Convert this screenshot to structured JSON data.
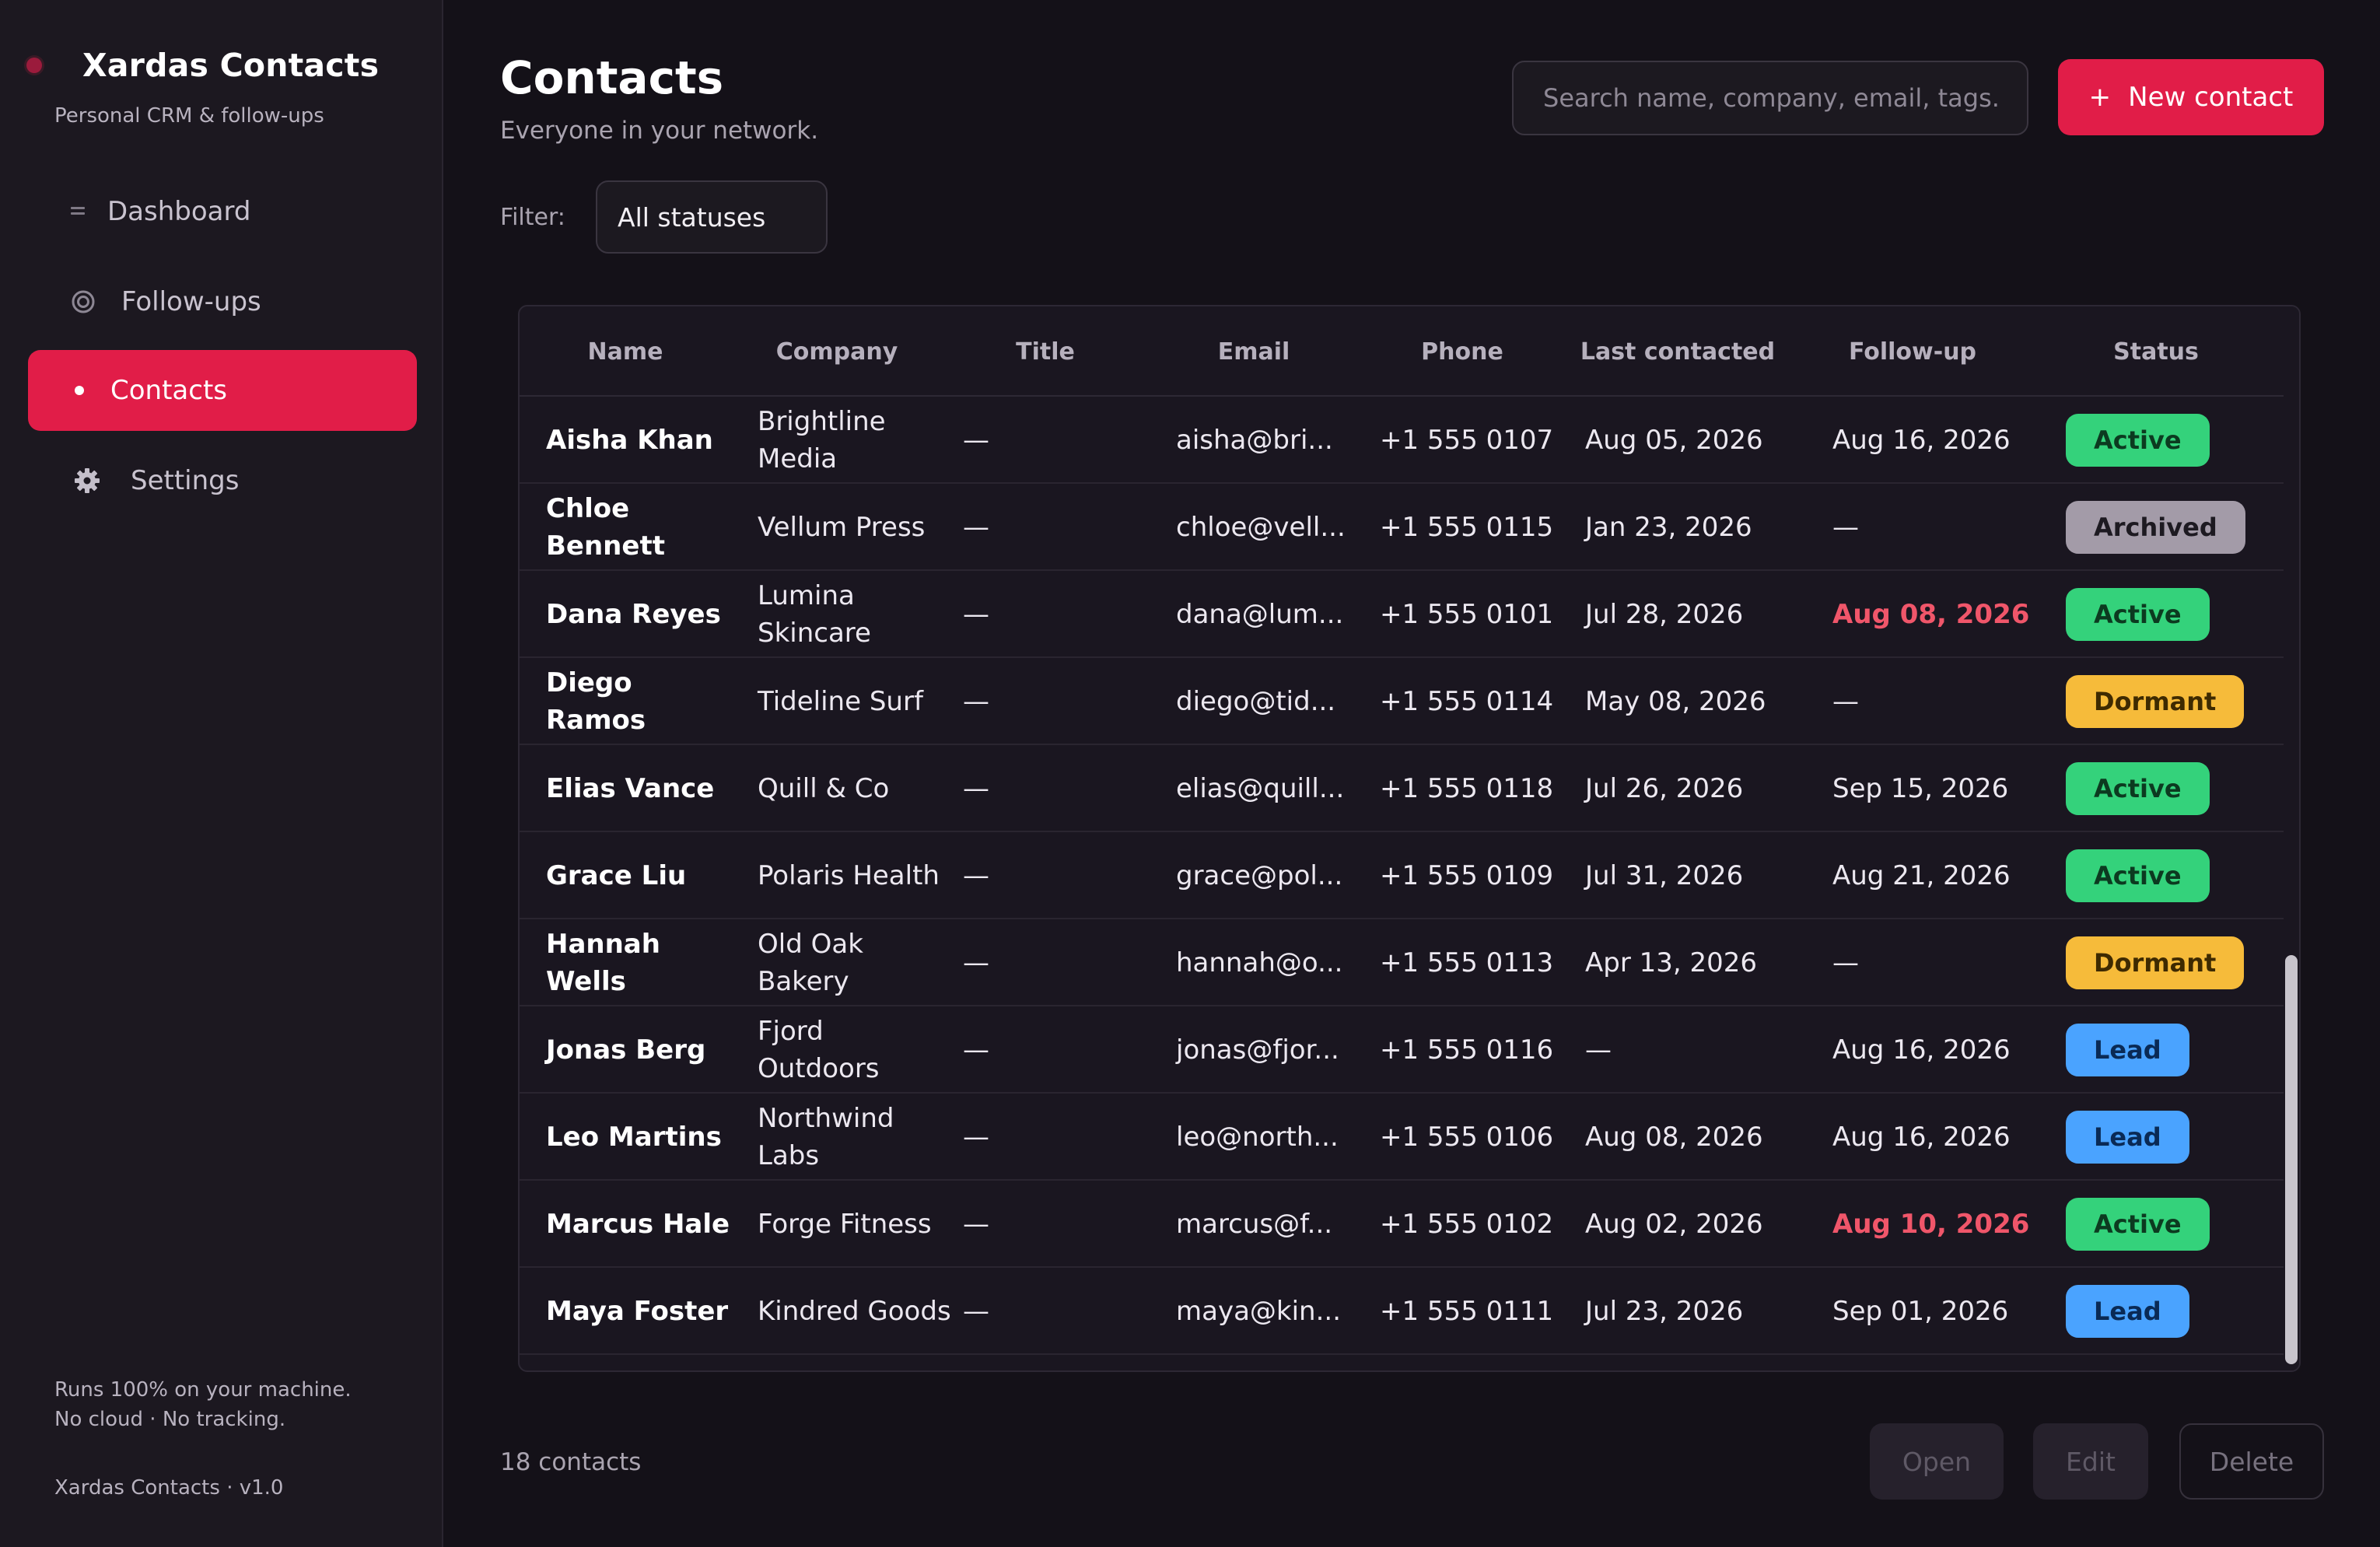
{
  "app": {
    "name": "Xardas Contacts",
    "tagline": "Personal CRM & follow-ups",
    "accent_color": "#e11d48"
  },
  "sidebar": {
    "items": [
      {
        "label": "Dashboard",
        "icon": "dashboard-icon",
        "active": false
      },
      {
        "label": "Follow-ups",
        "icon": "target-icon",
        "active": false
      },
      {
        "label": "Contacts",
        "icon": "dot-icon",
        "active": true
      },
      {
        "label": "Settings",
        "icon": "gear-icon",
        "active": false
      }
    ],
    "privacy_line1": "Runs 100% on your machine.",
    "privacy_line2": "No cloud · No tracking.",
    "version": "Xardas Contacts · v1.0"
  },
  "header": {
    "title": "Contacts",
    "subtitle": "Everyone in your network.",
    "search_placeholder": "Search name, company, email, tags...",
    "new_button_icon": "+",
    "new_button_label": "New contact"
  },
  "filter": {
    "label": "Filter:",
    "selected": "All statuses"
  },
  "table": {
    "columns": [
      "Name",
      "Company",
      "Title",
      "Email",
      "Phone",
      "Last contacted",
      "Follow-up",
      "Status"
    ],
    "rows": [
      {
        "name": "Aisha Khan",
        "company": "Brightline Media",
        "title": "—",
        "email": "aisha@bri...",
        "phone": "+1 555 0107",
        "last": "Aug 05, 2026",
        "follow": "Aug 16, 2026",
        "overdue": false,
        "status": "Active"
      },
      {
        "name": "Chloe Bennett",
        "company": "Vellum Press",
        "title": "—",
        "email": "chloe@vell...",
        "phone": "+1 555 0115",
        "last": "Jan 23, 2026",
        "follow": "—",
        "overdue": false,
        "status": "Archived"
      },
      {
        "name": "Dana Reyes",
        "company": "Lumina Skincare",
        "title": "—",
        "email": "dana@lum...",
        "phone": "+1 555 0101",
        "last": "Jul 28, 2026",
        "follow": "Aug 08, 2026",
        "overdue": true,
        "status": "Active"
      },
      {
        "name": "Diego Ramos",
        "company": "Tideline Surf",
        "title": "—",
        "email": "diego@tid...",
        "phone": "+1 555 0114",
        "last": "May 08, 2026",
        "follow": "—",
        "overdue": false,
        "status": "Dormant"
      },
      {
        "name": "Elias Vance",
        "company": "Quill & Co",
        "title": "—",
        "email": "elias@quill...",
        "phone": "+1 555 0118",
        "last": "Jul 26, 2026",
        "follow": "Sep 15, 2026",
        "overdue": false,
        "status": "Active"
      },
      {
        "name": "Grace Liu",
        "company": "Polaris Health",
        "title": "—",
        "email": "grace@pol...",
        "phone": "+1 555 0109",
        "last": "Jul 31, 2026",
        "follow": "Aug 21, 2026",
        "overdue": false,
        "status": "Active"
      },
      {
        "name": "Hannah Wells",
        "company": "Old Oak Bakery",
        "title": "—",
        "email": "hannah@o...",
        "phone": "+1 555 0113",
        "last": "Apr 13, 2026",
        "follow": "—",
        "overdue": false,
        "status": "Dormant"
      },
      {
        "name": "Jonas Berg",
        "company": "Fjord Outdoors",
        "title": "—",
        "email": "jonas@fjor...",
        "phone": "+1 555 0116",
        "last": "—",
        "follow": "Aug 16, 2026",
        "overdue": false,
        "status": "Lead"
      },
      {
        "name": "Leo Martins",
        "company": "Northwind Labs",
        "title": "—",
        "email": "leo@north...",
        "phone": "+1 555 0106",
        "last": "Aug 08, 2026",
        "follow": "Aug 16, 2026",
        "overdue": false,
        "status": "Lead"
      },
      {
        "name": "Marcus Hale",
        "company": "Forge Fitness",
        "title": "—",
        "email": "marcus@f...",
        "phone": "+1 555 0102",
        "last": "Aug 02, 2026",
        "follow": "Aug 10, 2026",
        "overdue": true,
        "status": "Active"
      },
      {
        "name": "Maya Foster",
        "company": "Kindred Goods",
        "title": "—",
        "email": "maya@kin...",
        "phone": "+1 555 0111",
        "last": "Jul 23, 2026",
        "follow": "Sep 01, 2026",
        "overdue": false,
        "status": "Lead"
      }
    ]
  },
  "status_colors": {
    "Active": "#34d27b",
    "Archived": "#a39ba8",
    "Dormant": "#f6bb3a",
    "Lead": "#4aa3ff",
    "overdue": "#f0566a"
  },
  "footer": {
    "count": "18 contacts",
    "open_label": "Open",
    "edit_label": "Edit",
    "delete_label": "Delete"
  }
}
